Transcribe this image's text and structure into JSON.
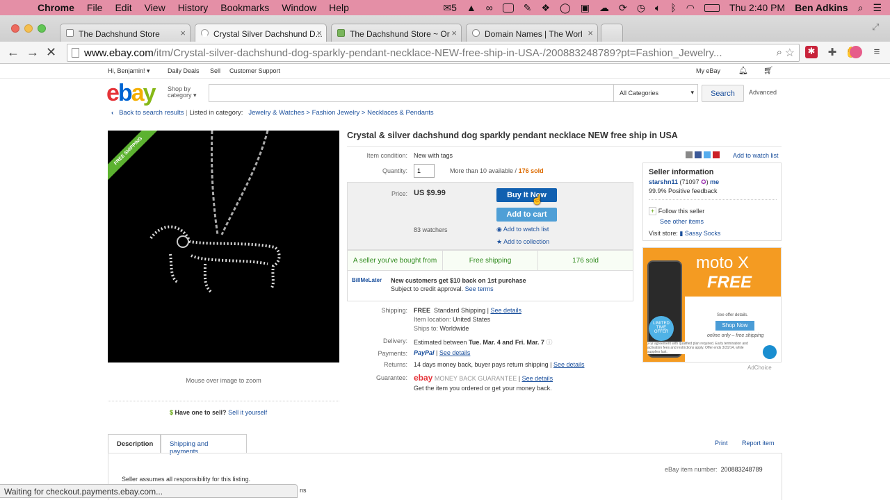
{
  "menubar": {
    "app": "Chrome",
    "items": [
      "File",
      "Edit",
      "View",
      "History",
      "Bookmarks",
      "Window",
      "Help"
    ],
    "badge_count": "5",
    "clock": "Thu 2:40 PM",
    "user": "Ben Adkins"
  },
  "tabs": [
    {
      "title": "The Dachshund Store"
    },
    {
      "title": "Crystal Silver Dachshund D..."
    },
    {
      "title": "The Dachshund Store ~ Or"
    },
    {
      "title": "Domain Names | The Worl"
    }
  ],
  "omnibox": {
    "domain": "www.ebay.com",
    "path": "/itm/Crystal-silver-dachshund-dog-sparkly-pendant-necklace-NEW-free-ship-in-USA-/200883248789?pt=Fashion_Jewelry..."
  },
  "globalheader": {
    "greeting": "Hi, Benjamin!",
    "daily_deals": "Daily Deals",
    "sell": "Sell",
    "customer_support": "Customer Support",
    "my_ebay": "My eBay"
  },
  "search": {
    "shop_by": "Shop by category",
    "placeholder": "",
    "category": "All Categories",
    "button": "Search",
    "advanced": "Advanced"
  },
  "breadcrumb": {
    "back": "Back to search results",
    "listed": "Listed in category:",
    "c1": "Jewelry & Watches",
    "c2": "Fashion Jewelry",
    "c3": "Necklaces & Pendants"
  },
  "image": {
    "ribbon": "FREE SHIPPING",
    "zoom_hint": "Mouse over image to zoom"
  },
  "item": {
    "title": "Crystal & silver dachshund dog sparkly pendant necklace NEW free ship in USA",
    "condition_label": "Item condition:",
    "condition": "New with tags",
    "quantity_label": "Quantity:",
    "quantity": "1",
    "available": "More than 10 available /",
    "sold": "176 sold",
    "share_watch": "Add to watch list",
    "price_label": "Price:",
    "price": "US $9.99",
    "buy_now": "Buy It Now",
    "add_cart": "Add to cart",
    "watchers": "83 watchers",
    "add_watch": "Add to watch list",
    "add_collection": "Add to collection",
    "features": [
      "A seller you've bought from",
      "Free shipping",
      "176 sold"
    ],
    "bml_logo": "BillMeLater",
    "bml_text": "New customers get $10 back on 1st purchase",
    "bml_sub": "Subject to credit approval.",
    "bml_terms": "See terms",
    "shipping_label": "Shipping:",
    "shipping_free": "FREE",
    "shipping_std": "Standard Shipping",
    "see_details": "See details",
    "location_label": "Item location:",
    "location": "United States",
    "ships_label": "Ships to:",
    "ships_to": "Worldwide",
    "delivery_label": "Delivery:",
    "delivery_pre": "Estimated between",
    "delivery": "Tue. Mar. 4 and Fri. Mar. 7",
    "payments_label": "Payments:",
    "paypal": "PayPal",
    "returns_label": "Returns:",
    "returns": "14 days money back, buyer pays return shipping",
    "guarantee_label": "Guarantee:",
    "guarantee_brand": "ebay",
    "guarantee": "MONEY BACK GUARANTEE",
    "guarantee_sub": "Get the item you ordered or get your money back.",
    "have_one": "Have one to sell?",
    "sell_it": "Sell it yourself"
  },
  "seller": {
    "heading": "Seller information",
    "name": "starshn11",
    "score": "(71097",
    "feedback": "99.9% Positive feedback",
    "follow": "Follow this seller",
    "other": "See other items",
    "visit": "Visit store:",
    "store": "Sassy Socks"
  },
  "ad": {
    "brand": "moto X",
    "free": "FREE",
    "badge": "LIMITED TIME OFFER",
    "offer_details": "See offer details.",
    "shop_now": "Shop Now",
    "online": "online only – free shipping",
    "fine": "2-yr agreement with qualified plan required. Early termination and activation fees and restrictions apply. Offer ends 3/31/14, while supplies last.",
    "adchoice": "AdChoice"
  },
  "desc_tabs": {
    "description": "Description",
    "shipping": "Shipping and payments",
    "print": "Print",
    "report": "Report item",
    "item_number_label": "eBay item number:",
    "item_number": "200883248789",
    "seller_note": "Seller assumes all responsibility for this listing.",
    "cut_text": "ns"
  },
  "status": "Waiting for checkout.payments.ebay.com..."
}
